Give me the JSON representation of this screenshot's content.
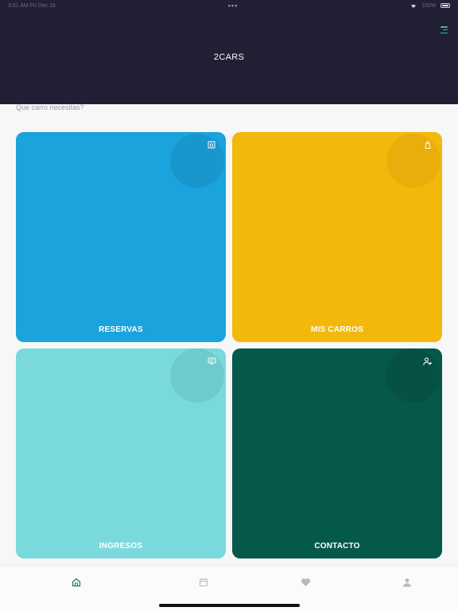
{
  "status_bar": {
    "left": "3:51 AM  Fri Dec 16",
    "center": "•••",
    "right": "100%"
  },
  "header": {
    "title": "2CARS"
  },
  "subtitle": "Que carro necesitas?",
  "tiles": [
    {
      "label": "RESERVAS",
      "icon": "calendar-badge-icon",
      "color": "#1aa3dc"
    },
    {
      "label": "MIS CARROS",
      "icon": "bag-icon",
      "color": "#f2b90c"
    },
    {
      "label": "INGRESOS",
      "icon": "receipt-icon",
      "color": "#7ad9dc"
    },
    {
      "label": "CONTACTO",
      "icon": "add-person-icon",
      "color": "#04594a"
    }
  ],
  "tabbar": {
    "items": [
      {
        "icon": "home-icon",
        "active": true
      },
      {
        "icon": "calendar-icon",
        "active": false
      },
      {
        "icon": "heart-icon",
        "active": false
      },
      {
        "icon": "user-icon",
        "active": false
      }
    ],
    "active_color": "#1f7a5a",
    "inactive_color": "#b8b8c2"
  }
}
